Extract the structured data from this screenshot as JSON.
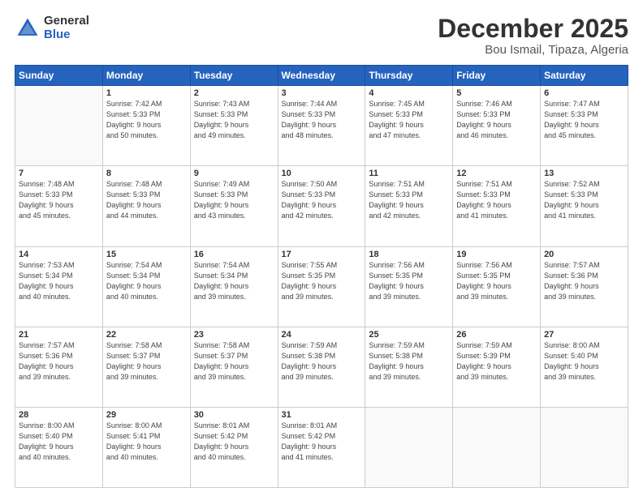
{
  "logo": {
    "general": "General",
    "blue": "Blue"
  },
  "title": "December 2025",
  "subtitle": "Bou Ismail, Tipaza, Algeria",
  "days_header": [
    "Sunday",
    "Monday",
    "Tuesday",
    "Wednesday",
    "Thursday",
    "Friday",
    "Saturday"
  ],
  "weeks": [
    [
      {
        "num": "",
        "info": ""
      },
      {
        "num": "1",
        "info": "Sunrise: 7:42 AM\nSunset: 5:33 PM\nDaylight: 9 hours\nand 50 minutes."
      },
      {
        "num": "2",
        "info": "Sunrise: 7:43 AM\nSunset: 5:33 PM\nDaylight: 9 hours\nand 49 minutes."
      },
      {
        "num": "3",
        "info": "Sunrise: 7:44 AM\nSunset: 5:33 PM\nDaylight: 9 hours\nand 48 minutes."
      },
      {
        "num": "4",
        "info": "Sunrise: 7:45 AM\nSunset: 5:33 PM\nDaylight: 9 hours\nand 47 minutes."
      },
      {
        "num": "5",
        "info": "Sunrise: 7:46 AM\nSunset: 5:33 PM\nDaylight: 9 hours\nand 46 minutes."
      },
      {
        "num": "6",
        "info": "Sunrise: 7:47 AM\nSunset: 5:33 PM\nDaylight: 9 hours\nand 45 minutes."
      }
    ],
    [
      {
        "num": "7",
        "info": "Sunrise: 7:48 AM\nSunset: 5:33 PM\nDaylight: 9 hours\nand 45 minutes."
      },
      {
        "num": "8",
        "info": "Sunrise: 7:48 AM\nSunset: 5:33 PM\nDaylight: 9 hours\nand 44 minutes."
      },
      {
        "num": "9",
        "info": "Sunrise: 7:49 AM\nSunset: 5:33 PM\nDaylight: 9 hours\nand 43 minutes."
      },
      {
        "num": "10",
        "info": "Sunrise: 7:50 AM\nSunset: 5:33 PM\nDaylight: 9 hours\nand 42 minutes."
      },
      {
        "num": "11",
        "info": "Sunrise: 7:51 AM\nSunset: 5:33 PM\nDaylight: 9 hours\nand 42 minutes."
      },
      {
        "num": "12",
        "info": "Sunrise: 7:51 AM\nSunset: 5:33 PM\nDaylight: 9 hours\nand 41 minutes."
      },
      {
        "num": "13",
        "info": "Sunrise: 7:52 AM\nSunset: 5:33 PM\nDaylight: 9 hours\nand 41 minutes."
      }
    ],
    [
      {
        "num": "14",
        "info": "Sunrise: 7:53 AM\nSunset: 5:34 PM\nDaylight: 9 hours\nand 40 minutes."
      },
      {
        "num": "15",
        "info": "Sunrise: 7:54 AM\nSunset: 5:34 PM\nDaylight: 9 hours\nand 40 minutes."
      },
      {
        "num": "16",
        "info": "Sunrise: 7:54 AM\nSunset: 5:34 PM\nDaylight: 9 hours\nand 39 minutes."
      },
      {
        "num": "17",
        "info": "Sunrise: 7:55 AM\nSunset: 5:35 PM\nDaylight: 9 hours\nand 39 minutes."
      },
      {
        "num": "18",
        "info": "Sunrise: 7:56 AM\nSunset: 5:35 PM\nDaylight: 9 hours\nand 39 minutes."
      },
      {
        "num": "19",
        "info": "Sunrise: 7:56 AM\nSunset: 5:35 PM\nDaylight: 9 hours\nand 39 minutes."
      },
      {
        "num": "20",
        "info": "Sunrise: 7:57 AM\nSunset: 5:36 PM\nDaylight: 9 hours\nand 39 minutes."
      }
    ],
    [
      {
        "num": "21",
        "info": "Sunrise: 7:57 AM\nSunset: 5:36 PM\nDaylight: 9 hours\nand 39 minutes."
      },
      {
        "num": "22",
        "info": "Sunrise: 7:58 AM\nSunset: 5:37 PM\nDaylight: 9 hours\nand 39 minutes."
      },
      {
        "num": "23",
        "info": "Sunrise: 7:58 AM\nSunset: 5:37 PM\nDaylight: 9 hours\nand 39 minutes."
      },
      {
        "num": "24",
        "info": "Sunrise: 7:59 AM\nSunset: 5:38 PM\nDaylight: 9 hours\nand 39 minutes."
      },
      {
        "num": "25",
        "info": "Sunrise: 7:59 AM\nSunset: 5:38 PM\nDaylight: 9 hours\nand 39 minutes."
      },
      {
        "num": "26",
        "info": "Sunrise: 7:59 AM\nSunset: 5:39 PM\nDaylight: 9 hours\nand 39 minutes."
      },
      {
        "num": "27",
        "info": "Sunrise: 8:00 AM\nSunset: 5:40 PM\nDaylight: 9 hours\nand 39 minutes."
      }
    ],
    [
      {
        "num": "28",
        "info": "Sunrise: 8:00 AM\nSunset: 5:40 PM\nDaylight: 9 hours\nand 40 minutes."
      },
      {
        "num": "29",
        "info": "Sunrise: 8:00 AM\nSunset: 5:41 PM\nDaylight: 9 hours\nand 40 minutes."
      },
      {
        "num": "30",
        "info": "Sunrise: 8:01 AM\nSunset: 5:42 PM\nDaylight: 9 hours\nand 40 minutes."
      },
      {
        "num": "31",
        "info": "Sunrise: 8:01 AM\nSunset: 5:42 PM\nDaylight: 9 hours\nand 41 minutes."
      },
      {
        "num": "",
        "info": ""
      },
      {
        "num": "",
        "info": ""
      },
      {
        "num": "",
        "info": ""
      }
    ]
  ]
}
